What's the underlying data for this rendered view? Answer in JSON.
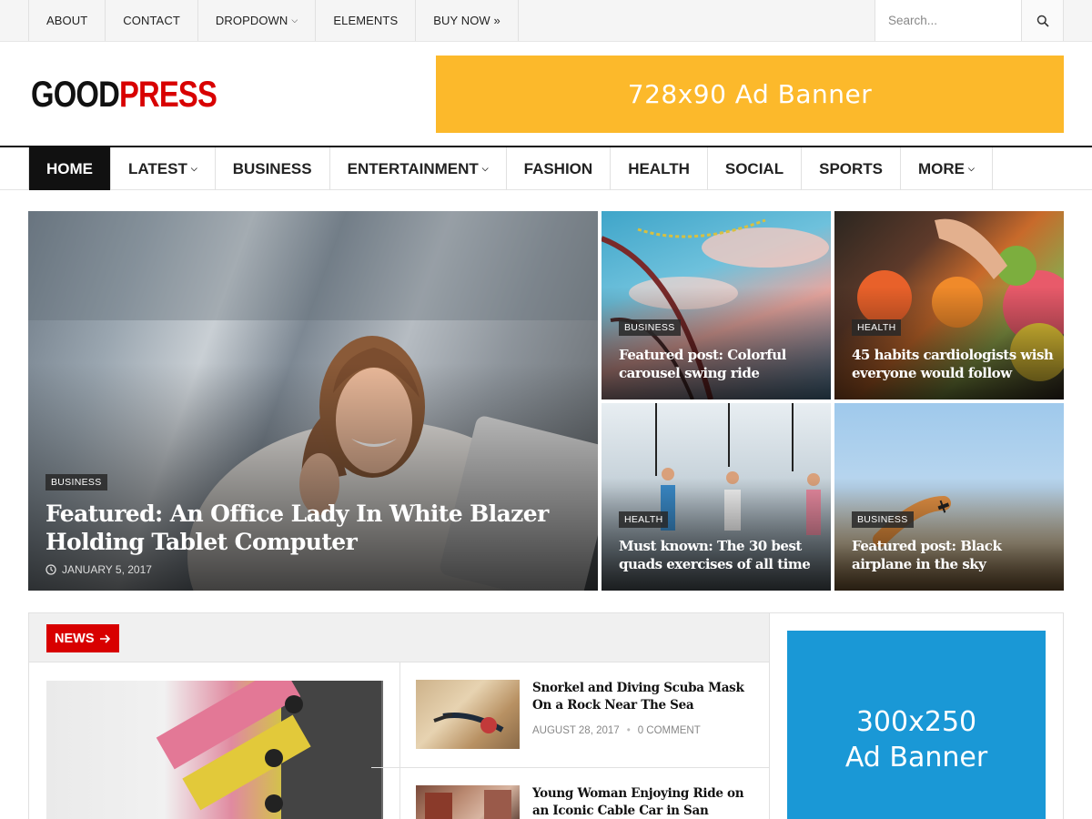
{
  "topbar": {
    "links": [
      {
        "label": "ABOUT"
      },
      {
        "label": "CONTACT"
      },
      {
        "label": "DROPDOWN",
        "has_dropdown": true
      },
      {
        "label": "ELEMENTS"
      },
      {
        "label": "BUY NOW »"
      }
    ],
    "search_placeholder": "Search...",
    "search_icon": "search-icon"
  },
  "header": {
    "logo_part1": "GOOD",
    "logo_part2": "PRESS",
    "ad_banner_text": "728x90 Ad Banner"
  },
  "mainnav": {
    "items": [
      {
        "label": "HOME",
        "active": true
      },
      {
        "label": "LATEST",
        "has_dropdown": true
      },
      {
        "label": "BUSINESS"
      },
      {
        "label": "ENTERTAINMENT",
        "has_dropdown": true
      },
      {
        "label": "FASHION"
      },
      {
        "label": "HEALTH"
      },
      {
        "label": "SOCIAL"
      },
      {
        "label": "SPORTS"
      },
      {
        "label": "MORE",
        "has_dropdown": true
      }
    ]
  },
  "featured": {
    "main": {
      "category": "BUSINESS",
      "title": "Featured: An Office Lady In White Blazer Holding Tablet Computer",
      "date": "JANUARY 5, 2017",
      "date_icon": "clock-icon"
    },
    "grid": [
      {
        "category": "BUSINESS",
        "title": "Featured post: Colorful carousel swing ride"
      },
      {
        "category": "HEALTH",
        "title": "45 habits cardiologists wish everyone would follow"
      },
      {
        "category": "HEALTH",
        "title": "Must known: The 30 best quads exercises of all time"
      },
      {
        "category": "BUSINESS",
        "title": "Featured post: Black airplane in the sky"
      }
    ]
  },
  "news": {
    "section_label": "NEWS",
    "arrow_icon": "arrow-right-icon",
    "items": [
      {
        "title": "Snorkel and Diving Scuba Mask On a Rock Near The Sea",
        "date": "AUGUST 28, 2017",
        "comments": "0 COMMENT"
      },
      {
        "title": "Young Woman Enjoying Ride on an Iconic Cable Car in San Francisco"
      }
    ]
  },
  "sidebar": {
    "ad_line1": "300x250",
    "ad_line2": "Ad Banner"
  },
  "colors": {
    "brand_red": "#d80000",
    "ad_top_yellow": "#fcb92b",
    "ad_side_blue": "#1a98d6",
    "nav_active": "#111111"
  }
}
